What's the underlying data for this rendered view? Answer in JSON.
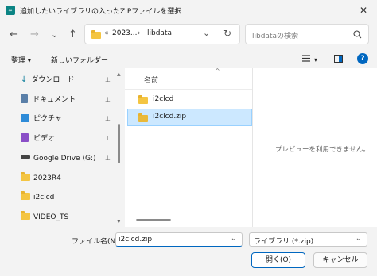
{
  "window": {
    "title": "追加したいライブラリの入ったZIPファイルを選択",
    "close_glyph": "✕"
  },
  "nav": {
    "back": "←",
    "forward": "→",
    "recent": "⌄",
    "up": "↑",
    "address": {
      "prefix": "«",
      "crumb1": "2023...",
      "sep": "›",
      "crumb2": "libdata",
      "dropdown": "⌄",
      "refresh": "↻"
    },
    "search_placeholder": "libdataの検索"
  },
  "cmdbar": {
    "organize": "整理",
    "organize_caret": "▾",
    "new_folder": "新しいフォルダー",
    "view_caret": "▾",
    "help": "?"
  },
  "sidebar": {
    "items": [
      {
        "label": "ダウンロード",
        "icon": "download-icon",
        "pinned": true
      },
      {
        "label": "ドキュメント",
        "icon": "document-icon",
        "pinned": true
      },
      {
        "label": "ピクチャ",
        "icon": "pictures-icon",
        "pinned": true
      },
      {
        "label": "ビデオ",
        "icon": "video-icon",
        "pinned": true
      },
      {
        "label": "Google Drive (G:)",
        "icon": "drive-icon",
        "pinned": true
      },
      {
        "label": "2023R4",
        "icon": "folder-icon",
        "pinned": false
      },
      {
        "label": "i2clcd",
        "icon": "folder-icon",
        "pinned": false
      },
      {
        "label": "VIDEO_TS",
        "icon": "folder-icon",
        "pinned": false
      }
    ],
    "pin_glyph": "📌"
  },
  "files": {
    "column_header": "名前",
    "sort_glyph": "^",
    "items": [
      {
        "name": "i2clcd",
        "type": "folder",
        "selected": false
      },
      {
        "name": "i2clcd.zip",
        "type": "zip",
        "selected": true
      }
    ]
  },
  "preview": {
    "message": "プレビューを利用できません。"
  },
  "footer": {
    "filename_label": "ファイル名(N):",
    "filename_value": "i2clcd.zip",
    "filter_value": "ライブラリ (*.zip)",
    "open_label": "開く(O)",
    "cancel_label": "キャンセル"
  },
  "colors": {
    "accent": "#0067c0",
    "selection": "#cce8ff",
    "folder": "#f4c542"
  }
}
